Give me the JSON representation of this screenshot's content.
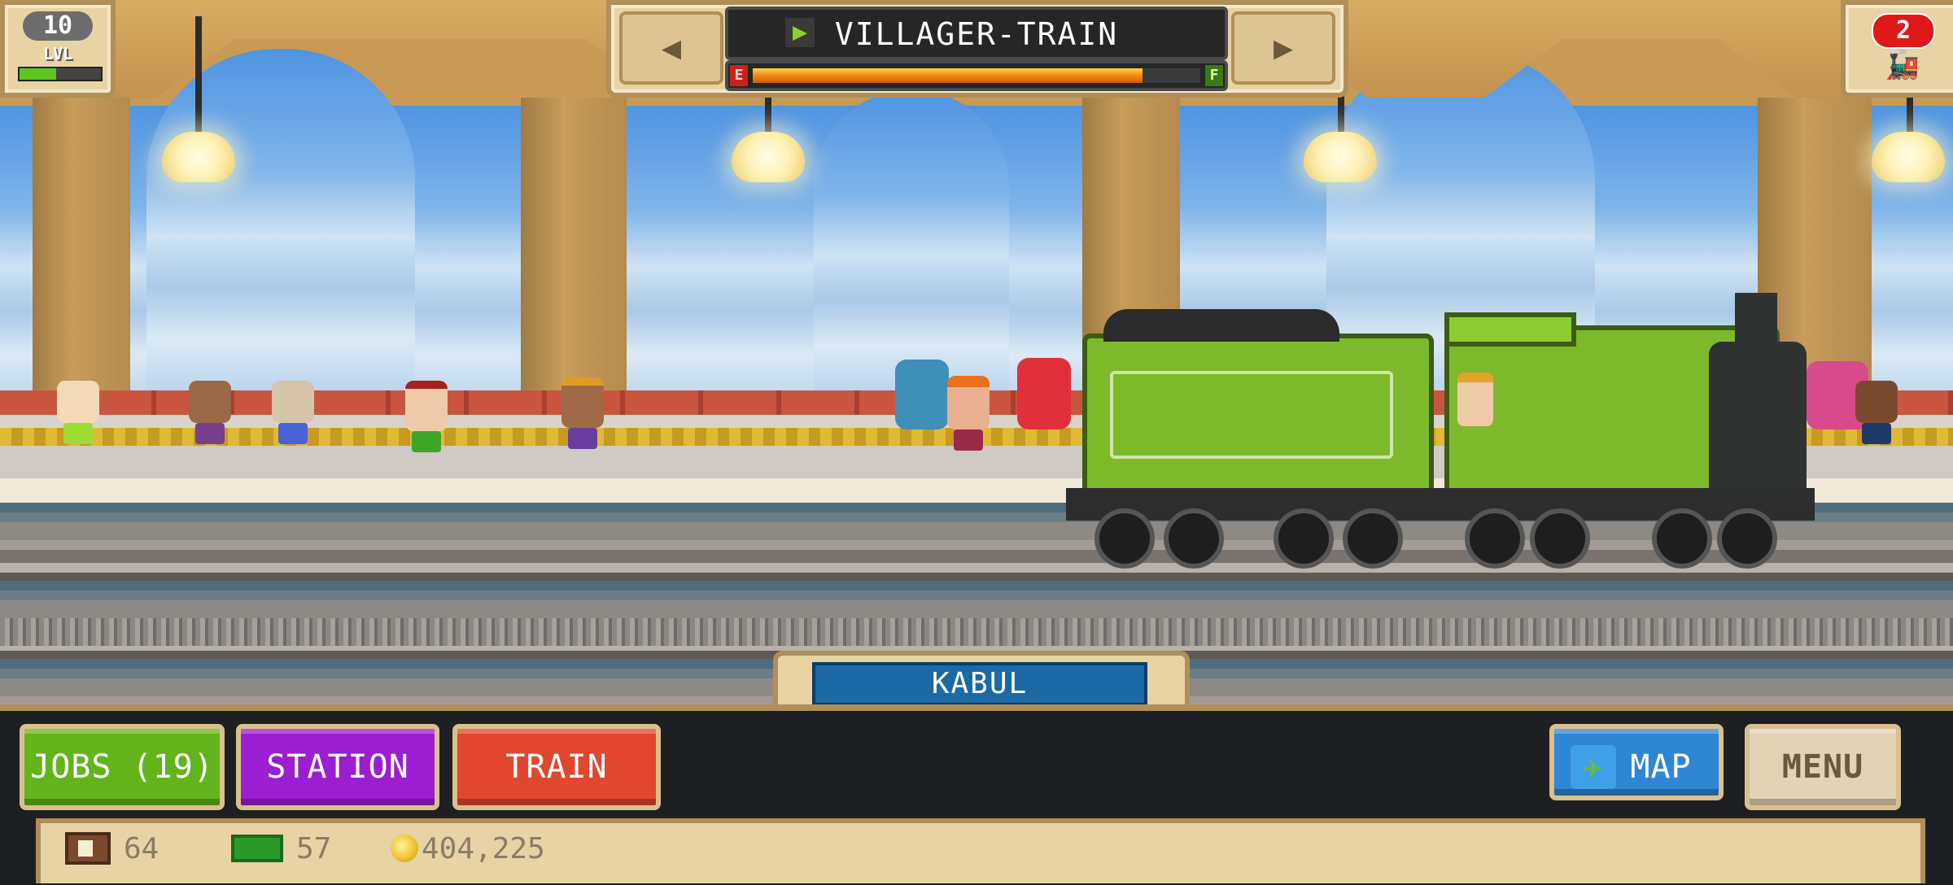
{
  "hud": {
    "level_value": "10",
    "level_label": "LVL",
    "level_progress": 0.45,
    "prev_icon": "◀",
    "next_icon": "▶",
    "train_name": "VILLAGER-TRAIN",
    "train_icon": "▶",
    "fuel_empty_label": "E",
    "fuel_full_label": "F",
    "fuel_level": 0.87,
    "train_count": "2",
    "train_count_icon": "train-icon"
  },
  "station": {
    "name": "KABUL"
  },
  "buttons": {
    "jobs": "JOBS (19)",
    "station": "STATION",
    "train": "TRAIN",
    "map": "MAP",
    "menu": "MENU"
  },
  "resources": {
    "crates": "64",
    "cash": "57",
    "coins": "404,225"
  },
  "colors": {
    "jobs": "#63b41a",
    "station": "#9b1fd0",
    "train": "#e0472e",
    "map": "#2f86d4",
    "station_plate": "#1b6aa5"
  }
}
